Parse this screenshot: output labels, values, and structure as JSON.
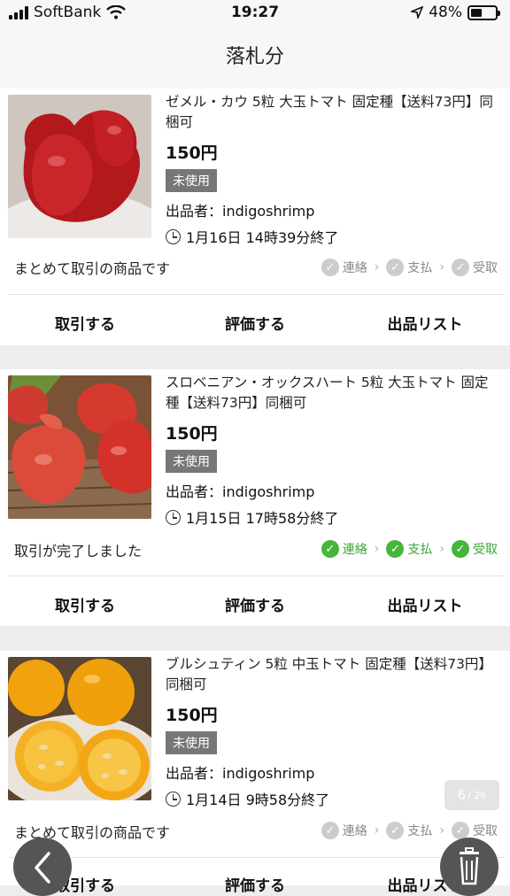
{
  "status_bar": {
    "carrier": "SoftBank",
    "time": "19:27",
    "battery": "48%"
  },
  "header": {
    "title": "落札分"
  },
  "items": [
    {
      "title": "ゼメル・カウ 5粒 大玉トマト 固定種【送料73円】同梱可",
      "price": "150円",
      "condition": "未使用",
      "seller": "出品者：indigoshrimp",
      "end_time": "1月16日 14時39分終了",
      "status": "まとめて取引の商品です",
      "steps": [
        {
          "label": "連絡"
        },
        {
          "label": "支払"
        },
        {
          "label": "受取"
        }
      ],
      "actions": [
        "取引する",
        "評価する",
        "出品リスト"
      ]
    },
    {
      "title": "スロベニアン・オックスハート 5粒 大玉トマト 固定種【送料73円】同梱可",
      "price": "150円",
      "condition": "未使用",
      "seller": "出品者：indigoshrimp",
      "end_time": "1月15日 17時58分終了",
      "status": "取引が完了しました",
      "steps": [
        {
          "label": "連絡"
        },
        {
          "label": "支払"
        },
        {
          "label": "受取"
        }
      ],
      "actions": [
        "取引する",
        "評価する",
        "出品リスト"
      ]
    },
    {
      "title": "ブルシュティン 5粒 中玉トマト 固定種【送料73円】同梱可",
      "price": "150円",
      "condition": "未使用",
      "seller": "出品者：indigoshrimp",
      "end_time": "1月14日 9時58分終了",
      "status": "まとめて取引の商品です",
      "steps": [
        {
          "label": "連絡"
        },
        {
          "label": "支払"
        },
        {
          "label": "受取"
        }
      ],
      "actions": [
        "取引する",
        "評価する",
        "出品リスト"
      ]
    }
  ],
  "pager": {
    "current": "6",
    "total": "/ 26"
  },
  "colors": {
    "step_done": "#47b43c",
    "step_pending": "#cccccc",
    "condition_badge": "#777777"
  }
}
